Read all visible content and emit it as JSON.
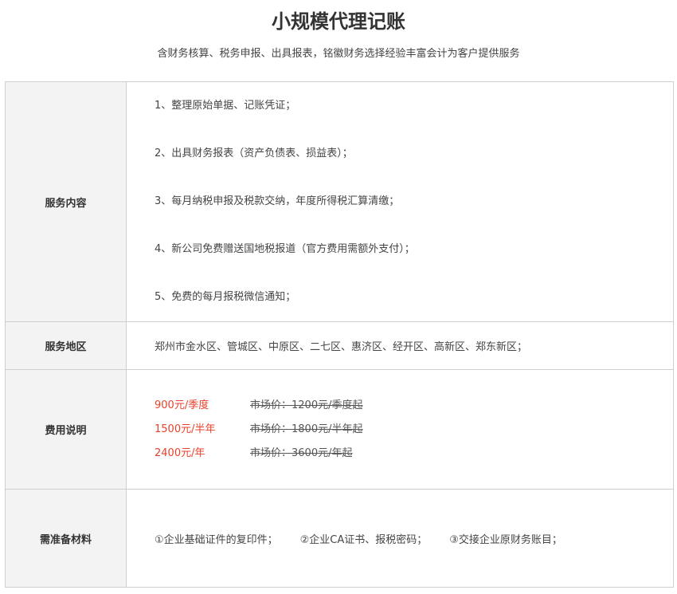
{
  "header": {
    "title": "小规模代理记账",
    "subtitle": "含财务核算、税务申报、出具报表，铭徽财务选择经验丰富会计为客户提供服务"
  },
  "table": {
    "services": {
      "label": "服务内容",
      "items": [
        "1、整理原始单据、记账凭证；",
        "2、出具财务报表（资产负债表、损益表）；",
        "3、每月纳税申报及税款交纳，年度所得税汇算清缴；",
        "4、新公司免费赠送国地税报道（官方费用需额外支付）；",
        "5、免费的每月报税微信通知；"
      ]
    },
    "region": {
      "label": "服务地区",
      "value": "郑州市金水区、管城区、中原区、二七区、惠济区、经开区、高新区、郑东新区；"
    },
    "fees": {
      "label": "费用说明",
      "items": [
        {
          "price": "900元/季度",
          "market": "市场价：1200元/季度起"
        },
        {
          "price": "1500元/半年",
          "market": "市场价：1800元/半年起"
        },
        {
          "price": "2400元/年",
          "market": "市场价：3600元/年起"
        }
      ]
    },
    "materials": {
      "label": "需准备材料",
      "items": [
        "①企业基础证件的复印件；",
        "②企业CA证书、报税密码；",
        "③交接企业原财务账目；"
      ]
    }
  },
  "colors": {
    "price_red": "#e8412c",
    "label_bg": "#f3f3f3",
    "border": "#cfcfcf"
  }
}
